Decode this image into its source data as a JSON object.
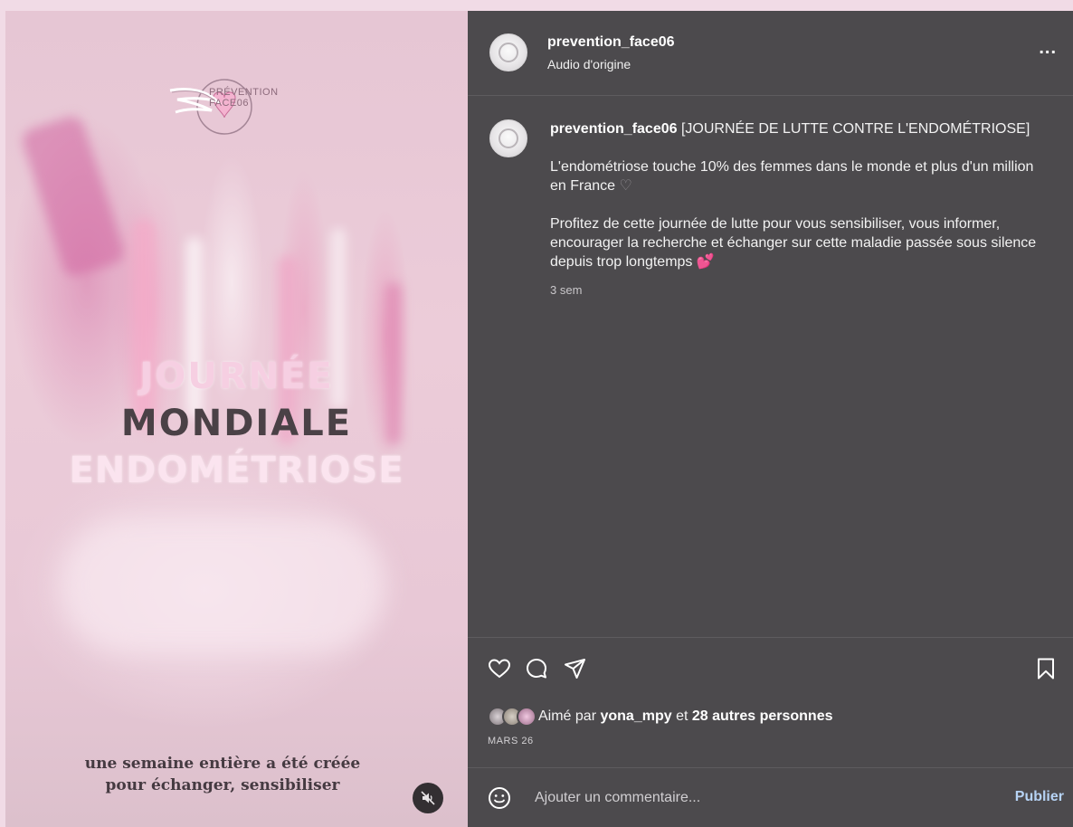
{
  "media": {
    "logo": {
      "line1": "PRÉVENTION",
      "line2": "FACE06"
    },
    "headline": {
      "line1": "JOURNÉE",
      "line2": "MONDIALE",
      "line3": "ENDOMÉTRIOSE"
    },
    "subtitle": {
      "line1": "une semaine entière a été créée",
      "line2": "pour échanger, sensibiliser"
    },
    "mute_icon": "speaker-muted-icon"
  },
  "header": {
    "username": "prevention_face06",
    "audio": "Audio d'origine",
    "more": "..."
  },
  "caption": {
    "username": "prevention_face06",
    "title": "[JOURNÉE DE LUTTE CONTRE L'ENDOMÉTRIOSE]",
    "paragraph1": "L'endométriose touche 10% des femmes dans le monde et plus d'un million en France",
    "paragraph2": "Profitez de cette journée de lutte pour vous sensibiliser, vous informer, encourager la recherche et échanger sur cette maladie passée sous silence depuis trop longtemps",
    "heart_emoji": "💕",
    "time_ago": "3 sem"
  },
  "actions": {
    "like_icon": "heart-outline-icon",
    "comment_icon": "speech-bubble-icon",
    "share_icon": "paper-plane-icon",
    "save_icon": "bookmark-icon"
  },
  "likes": {
    "prefix": "Aimé par",
    "user": "yona_mpy",
    "connector": "et",
    "others": "28 autres personnes"
  },
  "date": "MARS 26",
  "comment": {
    "placeholder": "Ajouter un commentaire...",
    "publish": "Publier"
  },
  "colors": {
    "panel_bg": "#4c4a4d",
    "publish": "#b6d3f5",
    "page_bg": "#f1dbe6"
  }
}
